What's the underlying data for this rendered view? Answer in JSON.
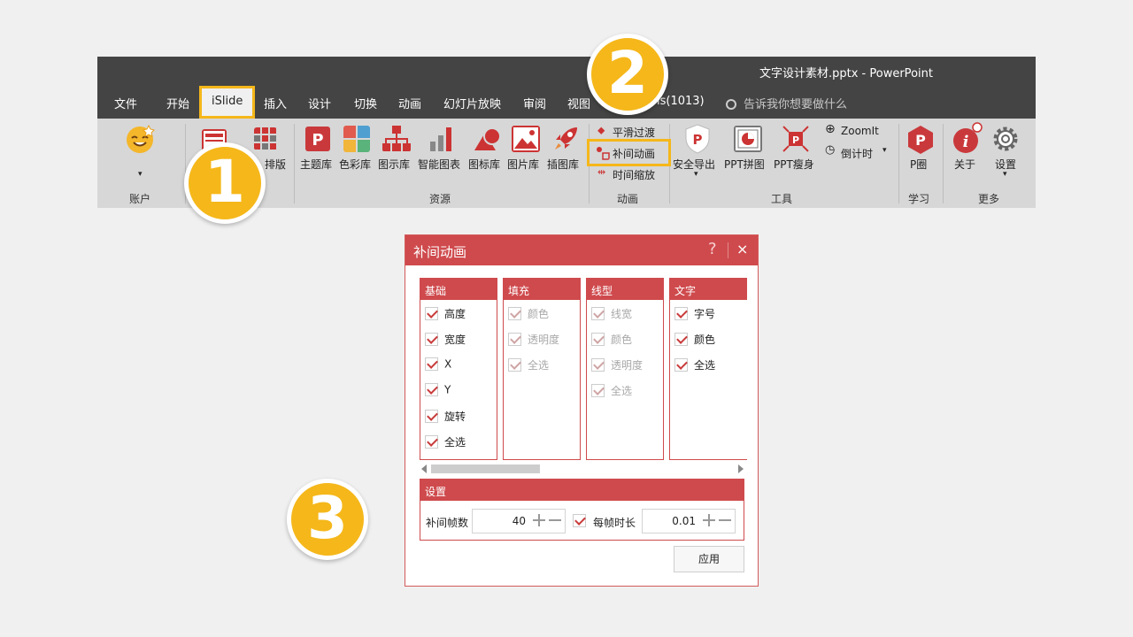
{
  "window": {
    "title": "文字设计素材.pptx  -  PowerPoint"
  },
  "menu": {
    "items": [
      "文件",
      "开始",
      "iSlide",
      "插入",
      "设计",
      "切换",
      "动画",
      "幻灯片放映",
      "审阅",
      "视图",
      "ls(1013)"
    ],
    "tell_me": "告诉我你想要做什么"
  },
  "ribbon": {
    "account": {
      "group": "账户"
    },
    "layout_partial": "排版",
    "resources": {
      "group": "资源",
      "items": [
        "主题库",
        "色彩库",
        "图示库",
        "智能图表",
        "图标库",
        "图片库",
        "插图库"
      ]
    },
    "animation": {
      "group": "动画",
      "items": [
        "平滑过渡",
        "补间动画",
        "时间缩放"
      ]
    },
    "tools": {
      "group": "工具",
      "items": [
        "安全导出",
        "PPT拼图",
        "PPT瘦身",
        "ZoomIt",
        "倒计时"
      ]
    },
    "learn": {
      "group": "学习",
      "item": "P圈"
    },
    "more": {
      "group": "更多",
      "items": [
        "关于",
        "设置"
      ]
    }
  },
  "badges": [
    "1",
    "2",
    "3"
  ],
  "dialog": {
    "title": "补间动画",
    "help": "?",
    "close": "×",
    "columns": [
      {
        "header": "基础",
        "items": [
          {
            "label": "高度",
            "checked": true,
            "enabled": true
          },
          {
            "label": "宽度",
            "checked": true,
            "enabled": true
          },
          {
            "label": "X",
            "checked": true,
            "enabled": true
          },
          {
            "label": "Y",
            "checked": true,
            "enabled": true
          },
          {
            "label": "旋转",
            "checked": true,
            "enabled": true
          },
          {
            "label": "全选",
            "checked": true,
            "enabled": true
          }
        ]
      },
      {
        "header": "填充",
        "items": [
          {
            "label": "颜色",
            "checked": true,
            "enabled": false
          },
          {
            "label": "透明度",
            "checked": true,
            "enabled": false
          },
          {
            "label": "全选",
            "checked": true,
            "enabled": false
          }
        ]
      },
      {
        "header": "线型",
        "items": [
          {
            "label": "线宽",
            "checked": true,
            "enabled": false
          },
          {
            "label": "颜色",
            "checked": true,
            "enabled": false
          },
          {
            "label": "透明度",
            "checked": true,
            "enabled": false
          },
          {
            "label": "全选",
            "checked": true,
            "enabled": false
          }
        ]
      },
      {
        "header": "文字",
        "items": [
          {
            "label": "字号",
            "checked": true,
            "enabled": true
          },
          {
            "label": "颜色",
            "checked": true,
            "enabled": true
          },
          {
            "label": "全选",
            "checked": true,
            "enabled": true
          }
        ]
      }
    ],
    "settings": {
      "header": "设置",
      "frames_label": "补间帧数",
      "frames_value": "40",
      "per_frame_checked": true,
      "per_frame_label": "每帧时长",
      "per_frame_value": "0.01"
    },
    "apply": "应用"
  },
  "colors": {
    "accent": "#cf4a4d",
    "highlight": "#f5b71a",
    "ribbon_dark": "#444444",
    "ribbon_light": "#d7d7d7"
  }
}
